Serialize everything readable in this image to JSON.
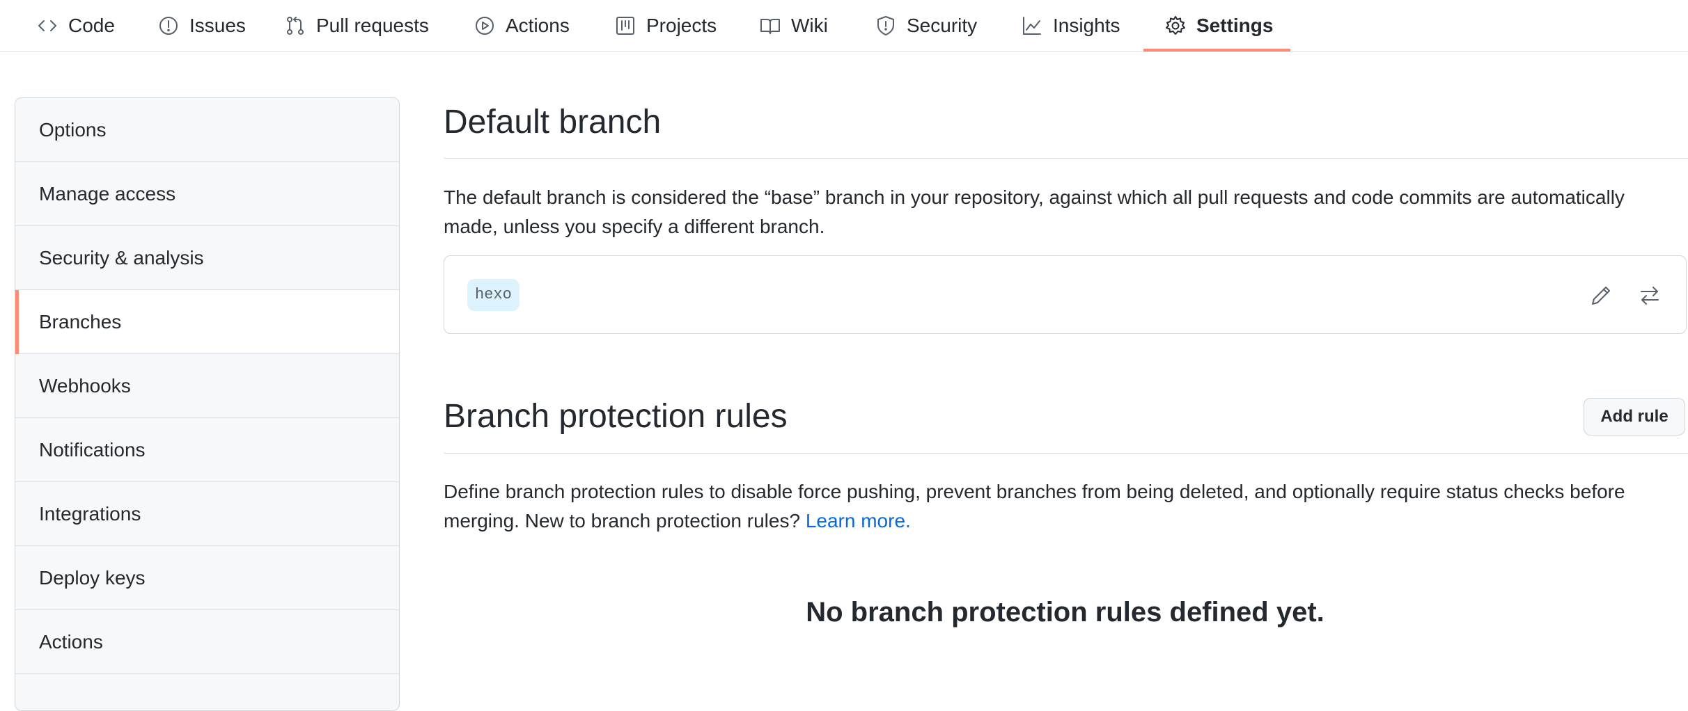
{
  "nav": {
    "tabs": [
      {
        "label": "Code",
        "icon": "code-icon"
      },
      {
        "label": "Issues",
        "icon": "issue-icon"
      },
      {
        "label": "Pull requests",
        "icon": "pull-request-icon"
      },
      {
        "label": "Actions",
        "icon": "play-icon"
      },
      {
        "label": "Projects",
        "icon": "project-icon"
      },
      {
        "label": "Wiki",
        "icon": "book-icon"
      },
      {
        "label": "Security",
        "icon": "shield-icon"
      },
      {
        "label": "Insights",
        "icon": "graph-icon"
      },
      {
        "label": "Settings",
        "icon": "gear-icon"
      }
    ],
    "selected": "Settings"
  },
  "sidebar": {
    "items": [
      {
        "label": "Options"
      },
      {
        "label": "Manage access"
      },
      {
        "label": "Security & analysis"
      },
      {
        "label": "Branches"
      },
      {
        "label": "Webhooks"
      },
      {
        "label": "Notifications"
      },
      {
        "label": "Integrations"
      },
      {
        "label": "Deploy keys"
      },
      {
        "label": "Actions"
      }
    ],
    "active": "Branches"
  },
  "default_branch": {
    "title": "Default branch",
    "description": "The default branch is considered the “base” branch in your repository, against which all pull requests and code commits are automatically made, unless you specify a different branch.",
    "branch_name": "hexo"
  },
  "protection": {
    "title": "Branch protection rules",
    "add_rule_label": "Add rule",
    "description": "Define branch protection rules to disable force pushing, prevent branches from being deleted, and optionally require status checks before merging. New to branch protection rules?",
    "learn_more": "Learn more.",
    "empty_message": "No branch protection rules defined yet."
  },
  "colors": {
    "accent_underline": "#fd8c73",
    "link": "#0969da",
    "branch_tag_bg": "#ddf4ff"
  }
}
